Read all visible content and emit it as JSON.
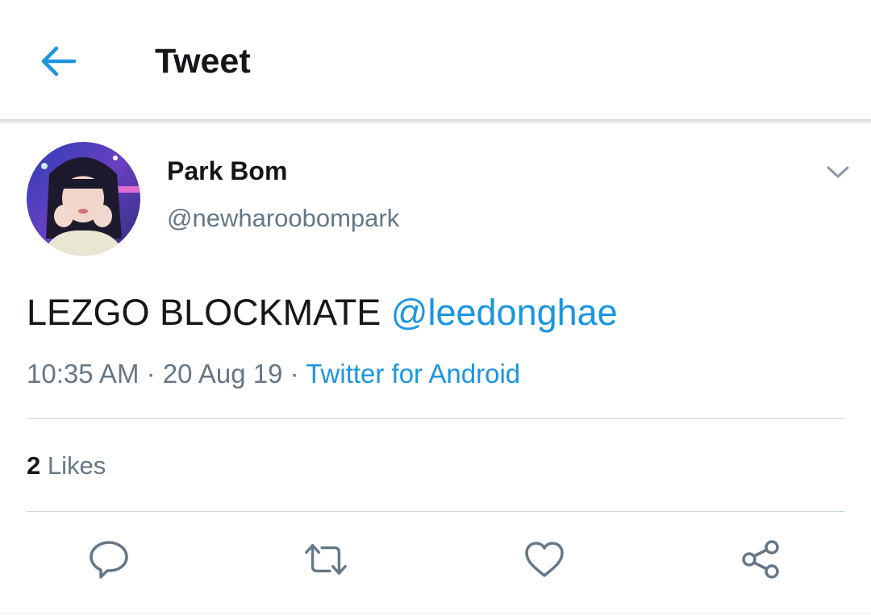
{
  "header": {
    "title": "Tweet",
    "back_icon": "arrow-left-icon"
  },
  "author": {
    "display_name": "Park Bom",
    "handle": "@newharoobompark",
    "avatar_icon": "profile-photo",
    "menu_icon": "chevron-down-icon"
  },
  "tweet": {
    "text": "LEZGO BLOCKMATE",
    "mention": "@leedonghae",
    "time": "10:35 AM",
    "separator": "·",
    "date": "20 Aug 19",
    "source": "Twitter for Android"
  },
  "stats": {
    "likes_count": "2",
    "likes_label": "Likes"
  },
  "actions": {
    "reply_icon": "reply-icon",
    "retweet_icon": "retweet-icon",
    "like_icon": "heart-icon",
    "share_icon": "share-icon"
  },
  "colors": {
    "accent": "#1b95e0",
    "text_primary": "#14171a",
    "text_secondary": "#657786",
    "divider": "#ccd6dd",
    "icon_gray": "#657786"
  }
}
